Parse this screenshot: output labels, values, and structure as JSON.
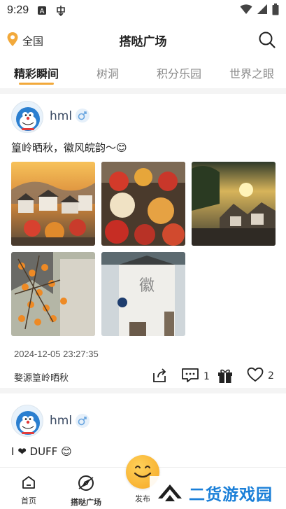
{
  "status_bar": {
    "time": "9:29"
  },
  "header": {
    "location_label": "全国",
    "title": "搭哒广场"
  },
  "tabs": [
    {
      "label": "精彩瞬间"
    },
    {
      "label": "树洞"
    },
    {
      "label": "积分乐园"
    },
    {
      "label": "世界之眼"
    }
  ],
  "posts": [
    {
      "user_name": "hml",
      "gender": "male",
      "text": "篁岭晒秋，徽风皖韵～😊",
      "photos": [
        "terraced-village-sunset",
        "crop-drying-baskets",
        "mountain-village-sunrise",
        "persimmon-tree-village",
        "huizhou-wall-sign"
      ],
      "date": "2024-12-05 23:27:35",
      "location": "婺源篁岭晒秋",
      "comment_count": "1",
      "like_count": "2"
    },
    {
      "user_name": "hml",
      "gender": "male",
      "text": "I ❤ DUFF 😊"
    }
  ],
  "bottom_nav": [
    {
      "label": "首页"
    },
    {
      "label": "搭哒广场"
    },
    {
      "label": "发布"
    }
  ],
  "watermark": {
    "text": "二货游戏园"
  },
  "colors": {
    "accent": "#f2a93b",
    "location_pin": "#f2a93b",
    "username": "#3a4a63",
    "gender_bg": "#e6f0fa"
  }
}
